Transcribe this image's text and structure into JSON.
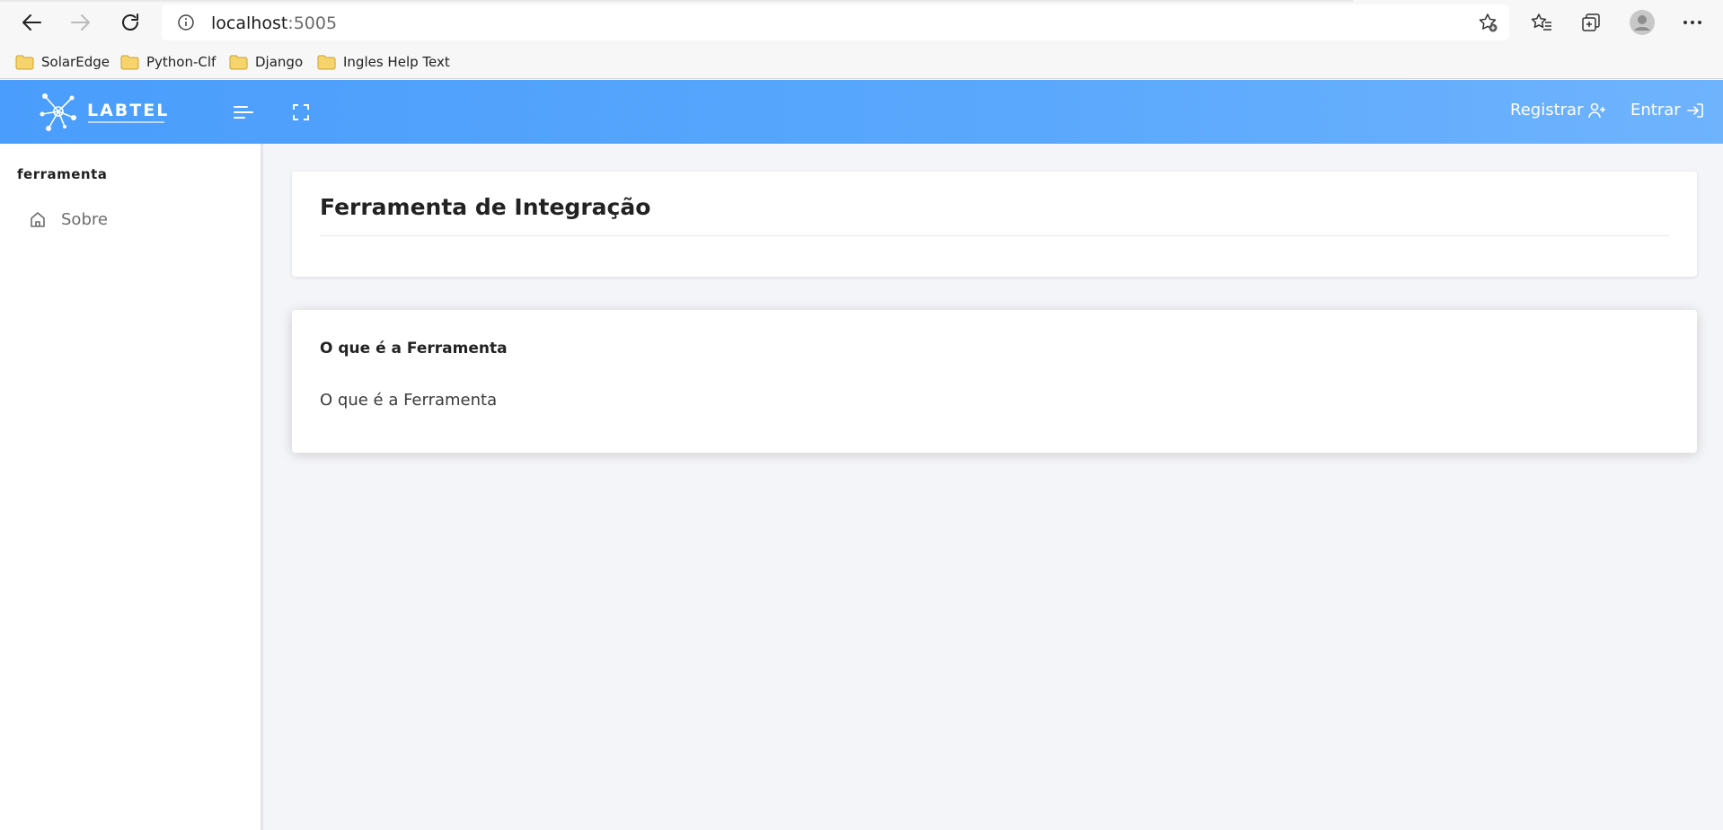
{
  "browser": {
    "url_host": "localhost",
    "url_port": ":5005",
    "bookmarks": [
      {
        "label": "SolarEdge"
      },
      {
        "label": "Python-Clf"
      },
      {
        "label": "Django"
      },
      {
        "label": "Ingles Help Text"
      }
    ]
  },
  "header": {
    "logo_text": "LABTEL",
    "register_label": "Registrar",
    "login_label": "Entrar",
    "accent_color": "#4a9dfc"
  },
  "sidebar": {
    "heading": "ferramenta",
    "items": [
      {
        "label": "Sobre",
        "icon": "home-icon"
      }
    ]
  },
  "main": {
    "page_title": "Ferramenta de Integração",
    "info_heading": "O que é a Ferramenta",
    "info_body": "O que é a Ferramenta"
  }
}
